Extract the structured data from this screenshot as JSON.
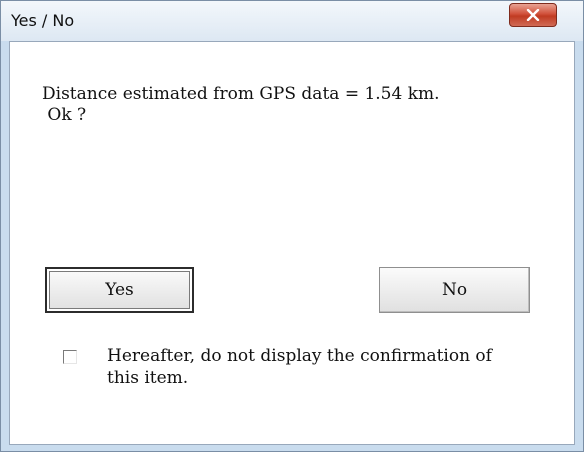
{
  "window": {
    "title": "Yes / No",
    "close_icon": "close-x-icon"
  },
  "message": {
    "line1": "Distance estimated from GPS data = 1.54 km.",
    "line2": " Ok ?"
  },
  "buttons": {
    "yes_label": "Yes",
    "no_label": "No"
  },
  "checkbox": {
    "checked": false,
    "label_line1": "Hereafter, do not display the confirmation of",
    "label_line2": "this item."
  }
}
